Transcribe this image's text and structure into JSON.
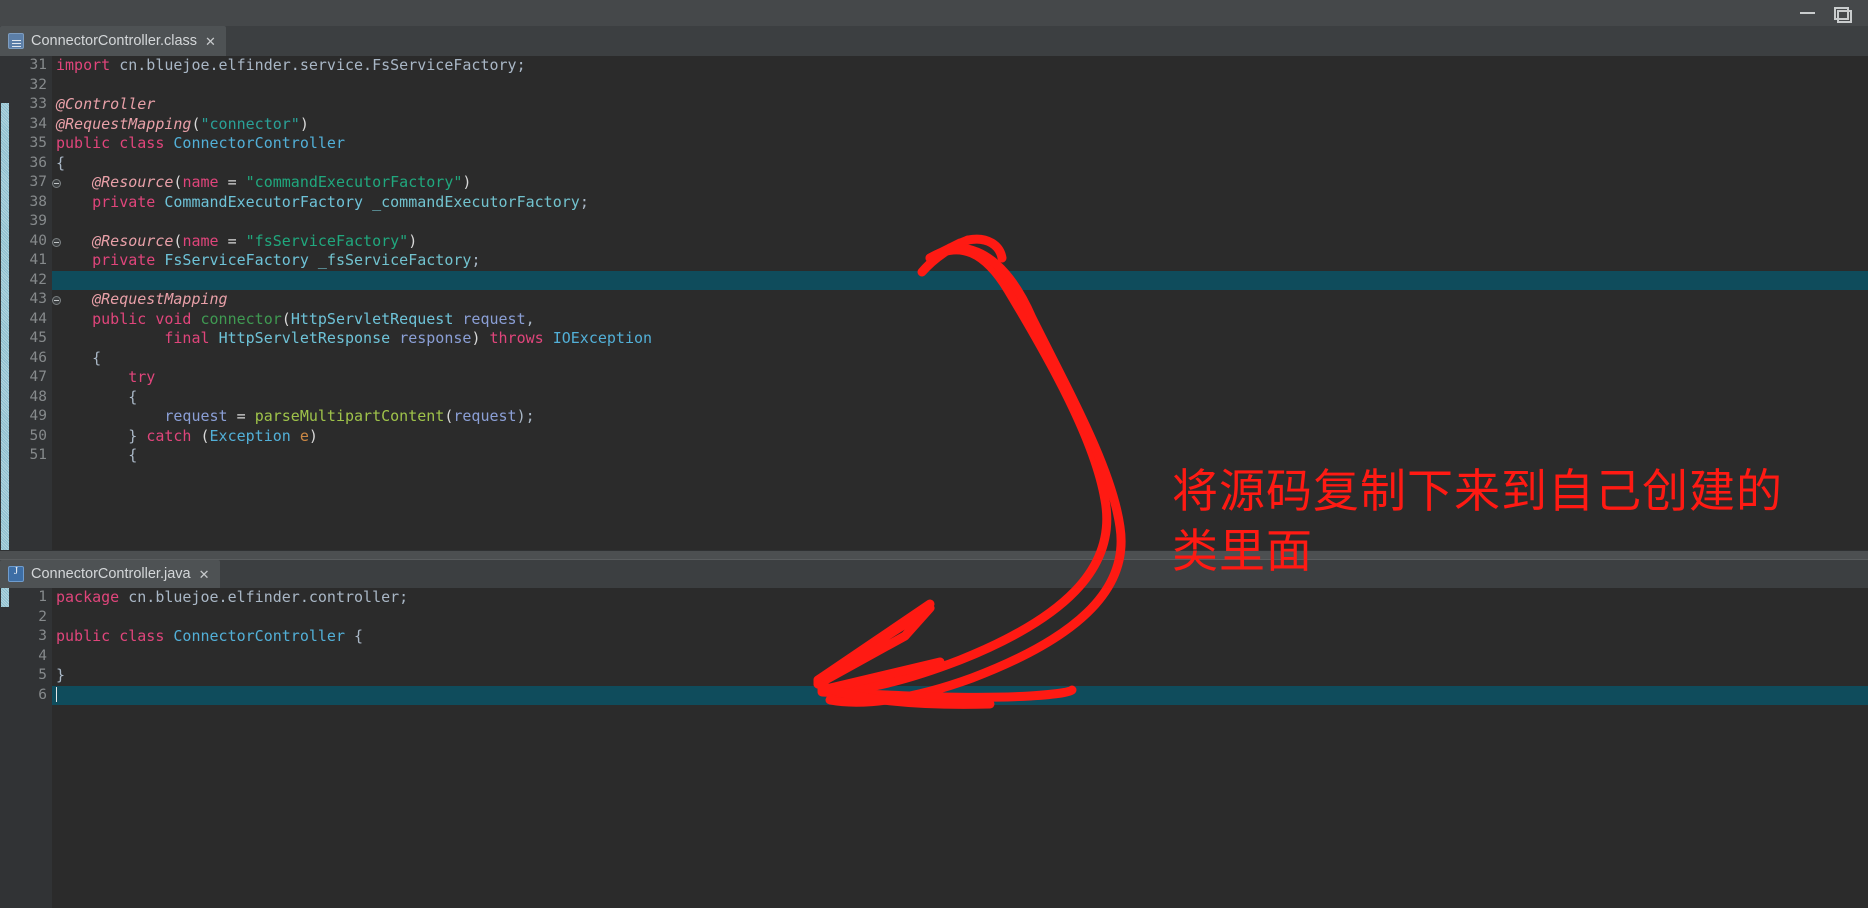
{
  "window": {
    "minimize_label": "—",
    "restore_label": "❐",
    "controls": [
      "minimize-button",
      "restore-button"
    ]
  },
  "top_pane": {
    "tab": {
      "label": "ConnectorController.class",
      "icon": "class-file-icon",
      "close_label": "✕"
    },
    "first_line_number": 31,
    "caret_line_number": 42,
    "fold_markers": [
      37,
      40,
      43
    ],
    "lines": [
      {
        "n": 31,
        "tokens": [
          {
            "t": "import ",
            "c": "kw2"
          },
          {
            "t": "cn.bluejoe.elfinder.service.FsServiceFactory;",
            "c": "pln"
          }
        ]
      },
      {
        "n": 32,
        "tokens": []
      },
      {
        "n": 33,
        "tokens": [
          {
            "t": "@Controller",
            "c": "ann"
          }
        ]
      },
      {
        "n": 34,
        "tokens": [
          {
            "t": "@RequestMapping",
            "c": "ann"
          },
          {
            "t": "(",
            "c": "op"
          },
          {
            "t": "\"connector\"",
            "c": "str"
          },
          {
            "t": ")",
            "c": "op"
          }
        ]
      },
      {
        "n": 35,
        "tokens": [
          {
            "t": "public class ",
            "c": "kw2"
          },
          {
            "t": "ConnectorController",
            "c": "typ"
          }
        ]
      },
      {
        "n": 36,
        "tokens": [
          {
            "t": "{",
            "c": "pln"
          }
        ]
      },
      {
        "n": 37,
        "tokens": [
          {
            "t": "    ",
            "c": "pln"
          },
          {
            "t": "@Resource",
            "c": "ann"
          },
          {
            "t": "(",
            "c": "op"
          },
          {
            "t": "name",
            "c": "kw2"
          },
          {
            "t": " = ",
            "c": "op"
          },
          {
            "t": "\"commandExecutorFactory\"",
            "c": "str2"
          },
          {
            "t": ")",
            "c": "op"
          }
        ]
      },
      {
        "n": 38,
        "tokens": [
          {
            "t": "    ",
            "c": "pln"
          },
          {
            "t": "private ",
            "c": "kw2"
          },
          {
            "t": "CommandExecutorFactory",
            "c": "typ2"
          },
          {
            "t": " ",
            "c": "pln"
          },
          {
            "t": "_commandExecutorFactory",
            "c": "fld"
          },
          {
            "t": ";",
            "c": "pln"
          }
        ]
      },
      {
        "n": 39,
        "tokens": []
      },
      {
        "n": 40,
        "tokens": [
          {
            "t": "    ",
            "c": "pln"
          },
          {
            "t": "@Resource",
            "c": "ann"
          },
          {
            "t": "(",
            "c": "op"
          },
          {
            "t": "name",
            "c": "kw2"
          },
          {
            "t": " = ",
            "c": "op"
          },
          {
            "t": "\"fsServiceFactory\"",
            "c": "str2"
          },
          {
            "t": ")",
            "c": "op"
          }
        ]
      },
      {
        "n": 41,
        "tokens": [
          {
            "t": "    ",
            "c": "pln"
          },
          {
            "t": "private ",
            "c": "kw2"
          },
          {
            "t": "FsServiceFactory",
            "c": "typ2"
          },
          {
            "t": " ",
            "c": "pln"
          },
          {
            "t": "_fsServiceFactory",
            "c": "fld"
          },
          {
            "t": ";",
            "c": "pln"
          }
        ]
      },
      {
        "n": 42,
        "tokens": []
      },
      {
        "n": 43,
        "tokens": [
          {
            "t": "    ",
            "c": "pln"
          },
          {
            "t": "@RequestMapping",
            "c": "ann"
          }
        ]
      },
      {
        "n": 44,
        "tokens": [
          {
            "t": "    ",
            "c": "pln"
          },
          {
            "t": "public void ",
            "c": "kw2"
          },
          {
            "t": "connector",
            "c": "mthg"
          },
          {
            "t": "(",
            "c": "op"
          },
          {
            "t": "HttpServletRequest",
            "c": "typ2"
          },
          {
            "t": " ",
            "c": "pln"
          },
          {
            "t": "request",
            "c": "var"
          },
          {
            "t": ",",
            "c": "pln"
          }
        ]
      },
      {
        "n": 45,
        "tokens": [
          {
            "t": "            ",
            "c": "pln"
          },
          {
            "t": "final ",
            "c": "kw2"
          },
          {
            "t": "HttpServletResponse",
            "c": "typ2"
          },
          {
            "t": " ",
            "c": "pln"
          },
          {
            "t": "response",
            "c": "var"
          },
          {
            "t": ")",
            "c": "op"
          },
          {
            "t": " ",
            "c": "pln"
          },
          {
            "t": "throws ",
            "c": "kw2"
          },
          {
            "t": "IOException",
            "c": "typ"
          }
        ]
      },
      {
        "n": 46,
        "tokens": [
          {
            "t": "    {",
            "c": "pln"
          }
        ]
      },
      {
        "n": 47,
        "tokens": [
          {
            "t": "        ",
            "c": "pln"
          },
          {
            "t": "try",
            "c": "kw2"
          }
        ]
      },
      {
        "n": 48,
        "tokens": [
          {
            "t": "        {",
            "c": "pln"
          }
        ]
      },
      {
        "n": 49,
        "tokens": [
          {
            "t": "            ",
            "c": "pln"
          },
          {
            "t": "request",
            "c": "var"
          },
          {
            "t": " = ",
            "c": "op"
          },
          {
            "t": "parseMultipartContent",
            "c": "mth"
          },
          {
            "t": "(",
            "c": "op"
          },
          {
            "t": "request",
            "c": "var"
          },
          {
            "t": ");",
            "c": "pln"
          }
        ]
      },
      {
        "n": 50,
        "tokens": [
          {
            "t": "        } ",
            "c": "pln"
          },
          {
            "t": "catch ",
            "c": "kw2"
          },
          {
            "t": "(",
            "c": "op"
          },
          {
            "t": "Exception",
            "c": "typ"
          },
          {
            "t": " ",
            "c": "pln"
          },
          {
            "t": "e",
            "c": "orng"
          },
          {
            "t": ")",
            "c": "op"
          }
        ]
      },
      {
        "n": 51,
        "tokens": [
          {
            "t": "        {",
            "c": "pln"
          }
        ]
      }
    ]
  },
  "bottom_pane": {
    "tab": {
      "label": "ConnectorController.java",
      "icon": "java-file-icon",
      "close_label": "✕"
    },
    "first_line_number": 1,
    "caret_line_number": 6,
    "lines": [
      {
        "n": 1,
        "tokens": [
          {
            "t": "package ",
            "c": "kw2"
          },
          {
            "t": "cn.bluejoe.elfinder.controller;",
            "c": "pln"
          }
        ]
      },
      {
        "n": 2,
        "tokens": []
      },
      {
        "n": 3,
        "tokens": [
          {
            "t": "public class ",
            "c": "kw2"
          },
          {
            "t": "ConnectorController",
            "c": "typ"
          },
          {
            "t": " {",
            "c": "pln"
          }
        ]
      },
      {
        "n": 4,
        "tokens": []
      },
      {
        "n": 5,
        "tokens": [
          {
            "t": "}",
            "c": "pln"
          }
        ]
      },
      {
        "n": 6,
        "tokens": []
      }
    ]
  },
  "annotation": {
    "color": "#ff1a13",
    "text_line_1": "将源码复制下来到自己创建的",
    "text_line_2": "类里面",
    "arrow_description": "hand-drawn red curved double-arrow pointing from top code pane down-left into the java file"
  },
  "colors": {
    "editor_background": "#2b2b2b",
    "gutter_background": "#313335",
    "caret_line": "#0f4c5c",
    "window_chrome": "#3c3f41",
    "tab_active": "#4e5254",
    "change_marker": "#a8d8e8",
    "annotation_red": "#ff1a13"
  }
}
